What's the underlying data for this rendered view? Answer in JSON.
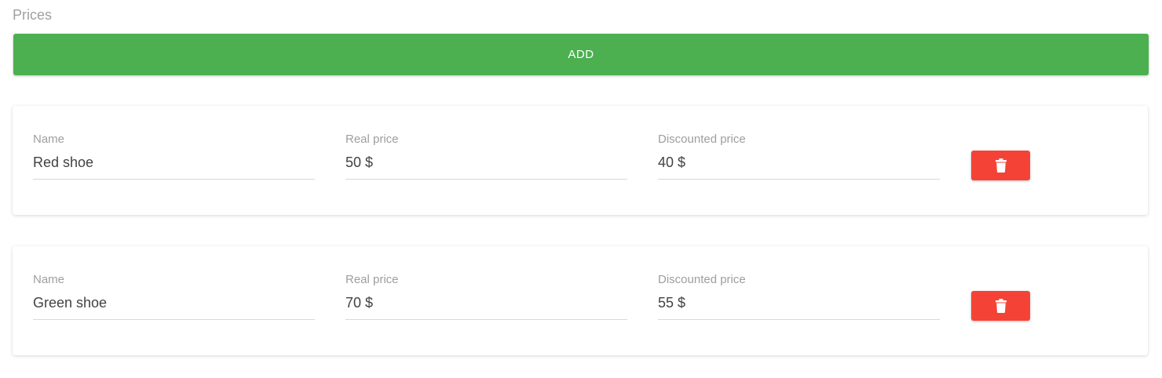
{
  "section": {
    "title": "Prices"
  },
  "toolbar": {
    "add_label": "ADD"
  },
  "colors": {
    "add": "#4caf50",
    "delete": "#f44336"
  },
  "items": [
    {
      "name_label": "Name",
      "name_value": "Red shoe",
      "real_label": "Real price",
      "real_value": "50 $",
      "discount_label": "Discounted price",
      "discount_value": "40 $",
      "delete_icon": "trash-icon"
    },
    {
      "name_label": "Name",
      "name_value": "Green shoe",
      "real_label": "Real price",
      "real_value": "70 $",
      "discount_label": "Discounted price",
      "discount_value": "55 $",
      "delete_icon": "trash-icon"
    }
  ]
}
